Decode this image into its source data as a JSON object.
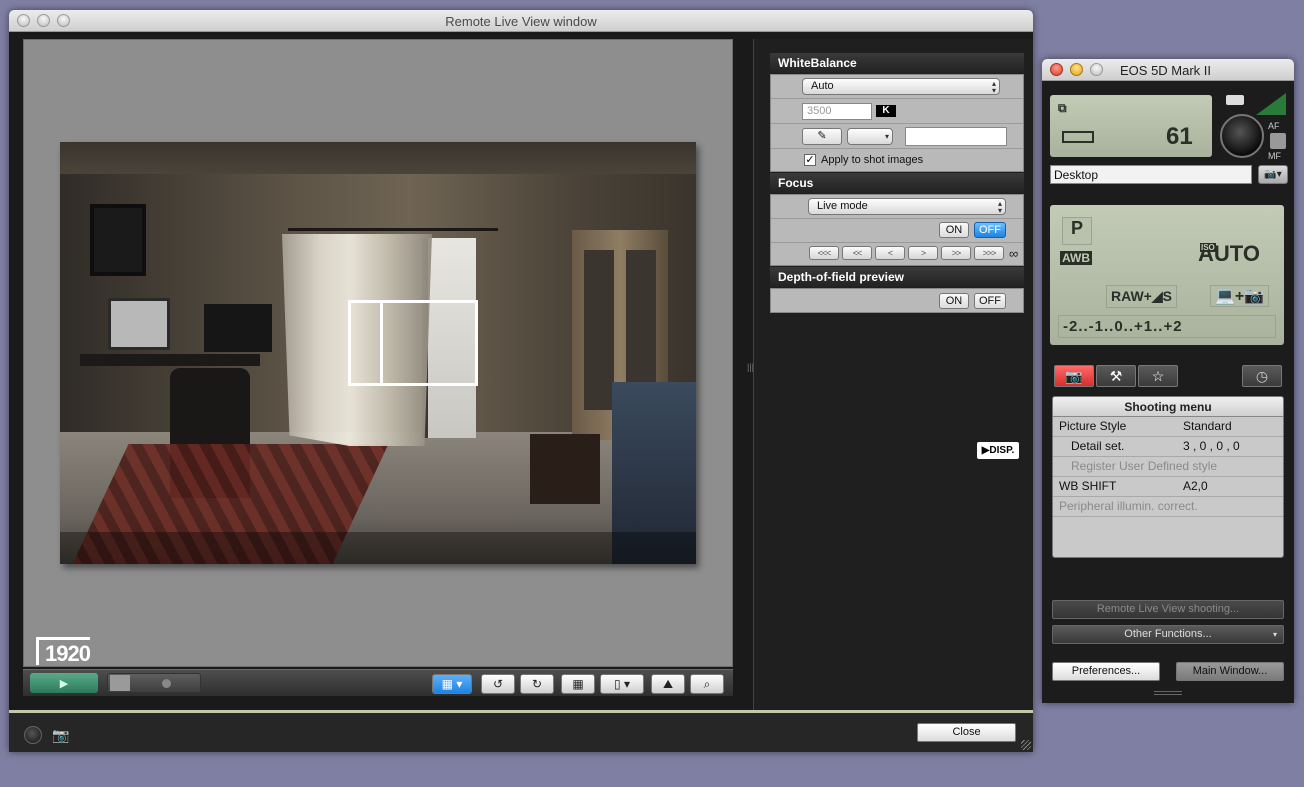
{
  "remote_live_view": {
    "title": "Remote Live View window",
    "resolution_badge": "1920",
    "right_panel": {
      "white_balance": {
        "header": "WhiteBalance",
        "mode": "Auto",
        "kelvin_placeholder": "3500",
        "kelvin_unit": "K",
        "apply_label": "Apply to shot images",
        "apply_checked": true
      },
      "focus": {
        "header": "Focus",
        "mode": "Live mode",
        "on_label": "ON",
        "off_label": "OFF",
        "selected": "OFF",
        "nav_buttons": [
          "<<<",
          "<<",
          "<",
          ">",
          ">>",
          ">>>"
        ],
        "infinity": "∞"
      },
      "depth_of_field": {
        "header": "Depth-of-field preview",
        "on_label": "ON",
        "off_label": "OFF"
      }
    },
    "disp_badge": "DISP.",
    "close_label": "Close"
  },
  "eos_window": {
    "title": "EOS 5D Mark II",
    "shots_remaining": "61",
    "save_destination": "Desktop",
    "af_label": "AF",
    "mf_label": "MF",
    "lcd": {
      "mode": "P",
      "wb": "AWB",
      "iso": "AUTO",
      "iso_tag": "ISO",
      "quality": "RAW+◢S",
      "exposure_scale": "-2..-1..0..+1..+2"
    },
    "tabs": [
      "shooting-tab",
      "setup-tab",
      "favorites-tab",
      "timer-tab"
    ],
    "shooting_menu": {
      "header": "Shooting menu",
      "items": [
        {
          "label": "Picture Style",
          "value": "Standard",
          "enabled": true
        },
        {
          "label": "Detail set.",
          "value": "3 , 0 , 0 , 0",
          "enabled": true
        },
        {
          "label": "Register User Defined style",
          "value": "",
          "enabled": false
        },
        {
          "label": "WB SHIFT",
          "value": "A2,0",
          "enabled": true
        },
        {
          "label": "Peripheral illumin. correct.",
          "value": "",
          "enabled": false
        }
      ]
    },
    "remote_live_view_shooting": "Remote Live View shooting...",
    "other_functions": "Other Functions...",
    "preferences": "Preferences...",
    "main_window": "Main Window..."
  },
  "colors": {
    "accent_blue": "#1e84e0",
    "play_green": "#2c7a5a",
    "lcd_green": "#b7c0ab",
    "tab_red": "#e23a3a"
  }
}
